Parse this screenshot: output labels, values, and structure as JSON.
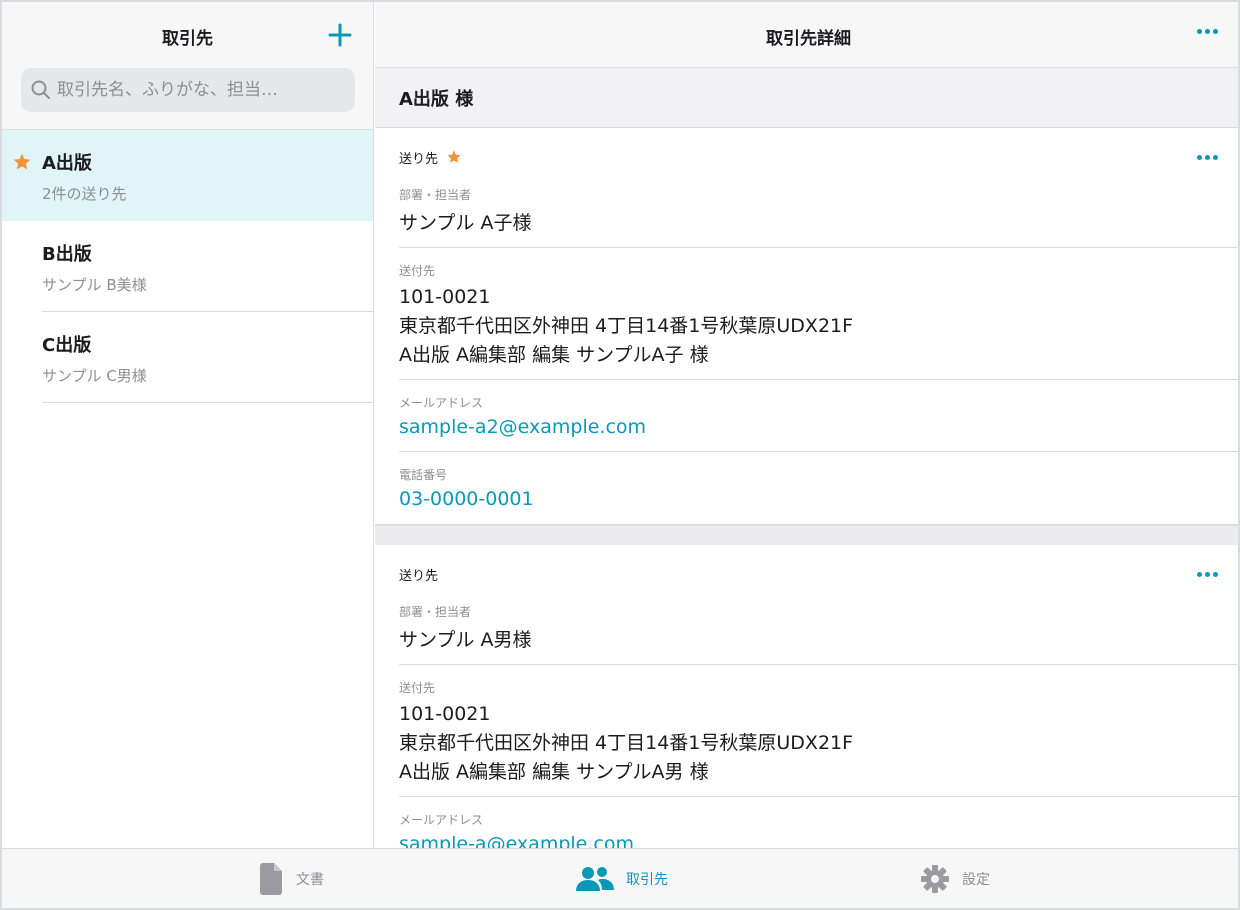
{
  "left": {
    "title": "取引先",
    "search_placeholder": "取引先名、ふりがな、担当…",
    "clients": [
      {
        "name": "A出版",
        "sub": "2件の送り先",
        "favorite": true
      },
      {
        "name": "B出版",
        "sub": "サンプル B美様",
        "favorite": false
      },
      {
        "name": "C出版",
        "sub": "サンプル C男様",
        "favorite": false
      }
    ]
  },
  "right": {
    "title": "取引先詳細",
    "company": "A出版 様",
    "cards": [
      {
        "heading": "送り先",
        "favorite": true,
        "dept_label": "部署・担当者",
        "dept_value": "サンプル A子様",
        "addr_label": "送付先",
        "addr_line1": "101-0021",
        "addr_line2": "東京都千代田区外神田 4丁目14番1号秋葉原UDX21F",
        "addr_line3": "A出版 A編集部 編集 サンプルA子 様",
        "mail_label": "メールアドレス",
        "mail_value": "sample-a2@example.com",
        "tel_label": "電話番号",
        "tel_value": "03-0000-0001"
      },
      {
        "heading": "送り先",
        "favorite": false,
        "dept_label": "部署・担当者",
        "dept_value": "サンプル A男様",
        "addr_label": "送付先",
        "addr_line1": "101-0021",
        "addr_line2": "東京都千代田区外神田 4丁目14番1号秋葉原UDX21F",
        "addr_line3": "A出版 A編集部 編集 サンプルA男 様",
        "mail_label": "メールアドレス",
        "mail_value": "sample-a@example.com"
      }
    ]
  },
  "tabs": {
    "documents": "文書",
    "clients": "取引先",
    "settings": "設定",
    "active": "clients"
  },
  "colors": {
    "accent": "#0a98b8",
    "star": "#f0953a",
    "selected_bg": "#e0f5f8"
  }
}
